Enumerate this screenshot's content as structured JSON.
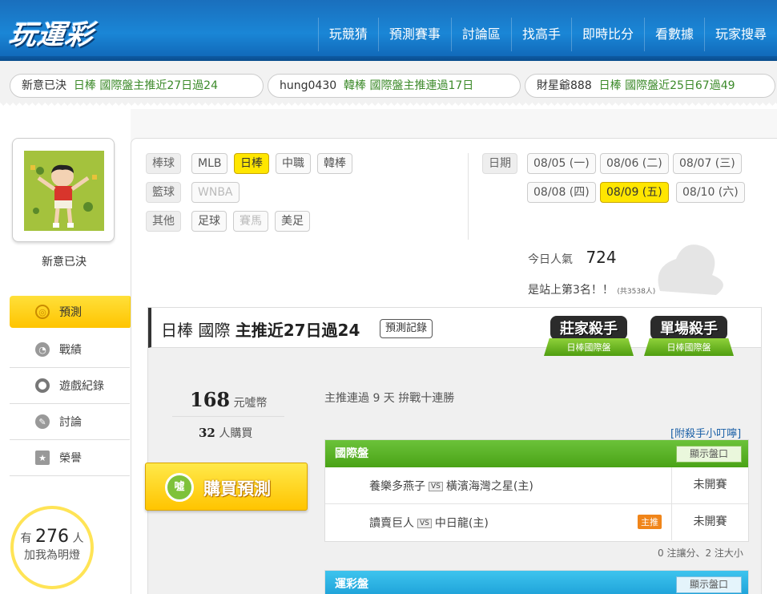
{
  "header": {
    "logo": "玩運彩",
    "nav": [
      "玩競猜",
      "預測賽事",
      "討論區",
      "找高手",
      "即時比分",
      "看數據",
      "玩家搜尋"
    ]
  },
  "ticker": [
    {
      "name": "新意已決",
      "text": "日棒  國際盤主推近27日過24"
    },
    {
      "name": "hung0430",
      "text": "韓棒  國際盤主推連過17日"
    },
    {
      "name": "財星爺888",
      "text": "日棒  國際盤近25日67過49"
    }
  ],
  "profile": {
    "username": "新意已決"
  },
  "menu": [
    {
      "label": "預測",
      "icon": "target-icon",
      "active": true
    },
    {
      "label": "戰績",
      "icon": "record-icon"
    },
    {
      "label": "遊戲紀錄",
      "icon": "circle-icon"
    },
    {
      "label": "討論",
      "icon": "pen-icon"
    },
    {
      "label": "榮譽",
      "icon": "medal-icon"
    }
  ],
  "fans": {
    "prefix": "有",
    "count": "276",
    "unit": "人",
    "cta": "加我為明燈"
  },
  "filters": {
    "baseball_label": "棒球",
    "baseball": [
      "MLB",
      "日棒",
      "中職",
      "韓棒"
    ],
    "baseball_selected": "日棒",
    "basketball_label": "籃球",
    "basketball": [
      "WNBA"
    ],
    "other_label": "其他",
    "other": [
      "足球",
      "賽馬",
      "美足"
    ],
    "date_label": "日期",
    "dates": [
      "08/05 (一)",
      "08/06 (二)",
      "08/07 (三)",
      "08/08 (四)",
      "08/09 (五)",
      "08/10 (六)"
    ],
    "date_selected": "08/09 (五)"
  },
  "popularity": {
    "label": "今日人氣",
    "value": "724",
    "rank_text": "是站上第3名！！",
    "rank_total": "(共3538人)"
  },
  "panel": {
    "title_league": "日棒 國際",
    "title_streak": "主推近27日過24",
    "record_button": "預測記錄",
    "badges": [
      {
        "top": "莊家殺手",
        "bottom": "日棒國際盤"
      },
      {
        "top": "單場殺手",
        "bottom": "日棒國際盤"
      }
    ],
    "price": "168",
    "price_unit": "元噓幣",
    "buyers": "32",
    "buyers_unit": "人購買",
    "buy_button": "購買預測",
    "coin_label": "噓",
    "streak_text": "主推連過 9 天  拚戰十連勝",
    "tip_link": "[附殺手小叮嚀]",
    "intl": {
      "title": "國際盤",
      "show": "顯示盤口",
      "games": [
        {
          "away": "養樂多燕子",
          "home": "橫濱海灣之星(主)",
          "status": "未開賽",
          "tag": ""
        },
        {
          "away": "讀賣巨人",
          "home": "中日龍(主)",
          "status": "未開賽",
          "tag": "主推"
        }
      ]
    },
    "note": "0 注讓分、2 注大小",
    "sports": {
      "title": "運彩盤",
      "show": "顯示盤口"
    }
  }
}
